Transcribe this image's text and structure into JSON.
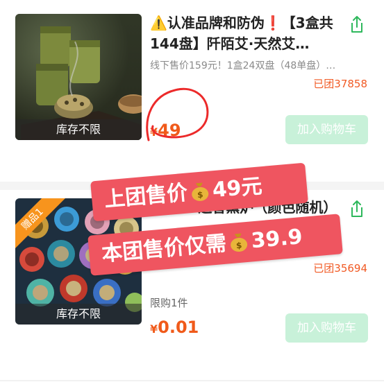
{
  "products": [
    {
      "title": "⚠️认准品牌和防伪❗【3盒共144盘】阡陌艾·天然艾…",
      "subtitle": "线下售价159元！1盒24双盘（48单盘）…",
      "grouped": "已团37858",
      "price_symbol": "¥",
      "price": "49",
      "stock_label": "库存不限",
      "cart_label": "加入购物车"
    },
    {
      "badge": "赠品1",
      "title": "【0.01送香熏炉（颜色随机）",
      "subtitle": "…",
      "grouped": "已团35694",
      "limit": "限购1件",
      "price_symbol": "¥",
      "price": "0.01",
      "stock_label": "库存不限",
      "cart_label": "加入购物车"
    }
  ],
  "overlay": {
    "banner1": {
      "prefix": "上团售价",
      "value": "49元"
    },
    "banner2": {
      "prefix": "本团售价仅需",
      "value": "39.9"
    }
  },
  "colors": {
    "accent_price": "#f05a1a",
    "cart_button": "#c8f1d9",
    "share_icon": "#2eb85c",
    "banner": "#ef5560"
  }
}
